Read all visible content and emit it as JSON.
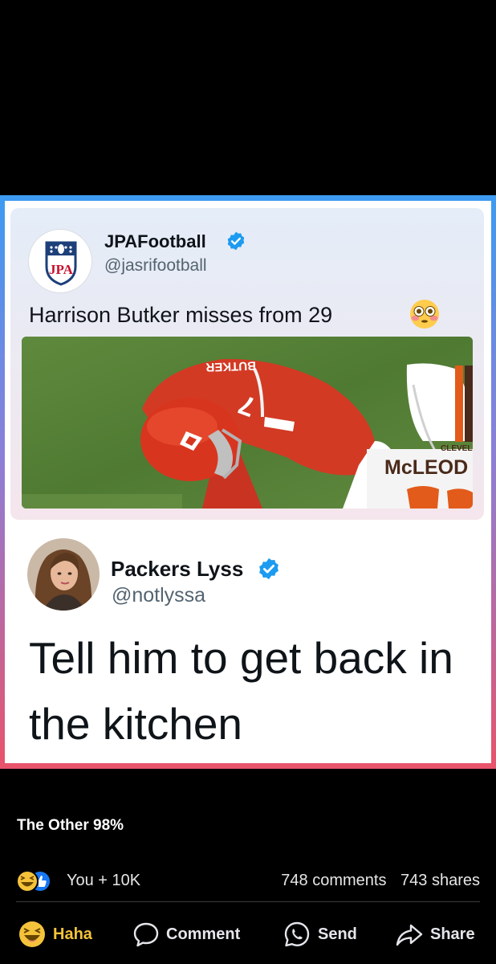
{
  "tweet_quoted": {
    "name": "JPAFootball",
    "handle": "@jasrifootball",
    "avatar_text": "JPA",
    "text": "Harrison Butker misses from 29",
    "emoji": "flushed-face-emoji",
    "photo_jersey_name": "BUTKER",
    "photo_jersey_number": "7",
    "photo_opponent_name": "McLEOD",
    "photo_opponent_team": "CLEVELAN"
  },
  "tweet_reply": {
    "name": "Packers Lyss",
    "handle": "@notlyssa",
    "text": "Tell him to get back in the kitchen"
  },
  "post": {
    "page_name": "The Other 98%",
    "reactions_label": "You + 10K",
    "comments": "748 comments",
    "shares": "743 shares"
  },
  "actions": {
    "haha": "Haha",
    "comment": "Comment",
    "send": "Send",
    "share": "Share"
  },
  "colors": {
    "haha_accent": "#f5c33b",
    "verified": "#1d9bf0",
    "frame_top": "#3d9bf2",
    "frame_bottom": "#e9536b"
  }
}
